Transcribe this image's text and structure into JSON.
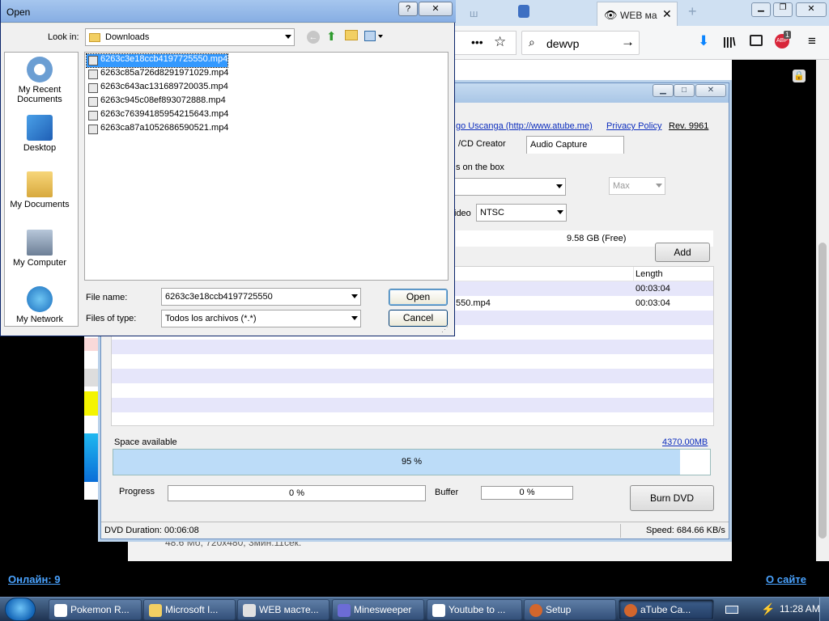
{
  "firefox": {
    "tab_title": "WEB ма",
    "search_value": "dewvp",
    "adblock_badge": "1"
  },
  "site": {
    "online": "Онлайн: 9",
    "about": "О сайте",
    "file_info": "48.6 Мб, 720x480, 3мин.11сек."
  },
  "atube": {
    "credit_link": "go Uscanga (http://www.atube.me)",
    "privacy_link": "Privacy Policy",
    "rev_link": "Rev. 9961",
    "tabs": [
      "/CD Creator",
      "Audio Capture"
    ],
    "text_on_box": "s on the box",
    "max_value": "Max",
    "video_std_prefix": "ideo",
    "video_std": "NTSC",
    "free_space": "9.58 GB (Free)",
    "add_label": "Add",
    "length_header": "Length",
    "rows": [
      {
        "name": "",
        "length": "00:03:04"
      },
      {
        "name": "550.mp4",
        "length": "00:03:04"
      }
    ],
    "space_label": "Space available",
    "space_value": "4370.00MB",
    "space_percent_text": "95 %",
    "space_fill": 0.95,
    "progress_label": "Progress",
    "progress_value": "0 %",
    "buffer_label": "Buffer",
    "buffer_value": "0 %",
    "burn_label": "Burn DVD",
    "dvd_duration": "DVD Duration: 00:06:08",
    "speed": "Speed: 684.66 KB/s"
  },
  "open_dialog": {
    "title": "Open",
    "look_in_label": "Look in:",
    "look_in_value": "Downloads",
    "places": [
      "My Recent Documents",
      "Desktop",
      "My Documents",
      "My Computer",
      "My Network"
    ],
    "files": [
      "6263c3e18ccb4197725550.mp4",
      "6263c85a726d8291971029.mp4",
      "6263c643ac131689720035.mp4",
      "6263c945c08ef893072888.mp4",
      "6263c76394185954215643.mp4",
      "6263ca87a1052686590521.mp4"
    ],
    "file_name_label": "File name:",
    "file_name_value": "6263c3e18ccb4197725550",
    "files_of_type_label": "Files of type:",
    "files_of_type_value": "Todos los archivos (*.*)",
    "open_label": "Open",
    "cancel_label": "Cancel"
  },
  "taskbar": {
    "items": [
      "Pokemon R...",
      "Microsoft I...",
      "WEB масте...",
      "Minesweeper",
      "Youtube to ...",
      "Setup",
      "aTube Ca..."
    ],
    "clock": "11:28 AM"
  }
}
